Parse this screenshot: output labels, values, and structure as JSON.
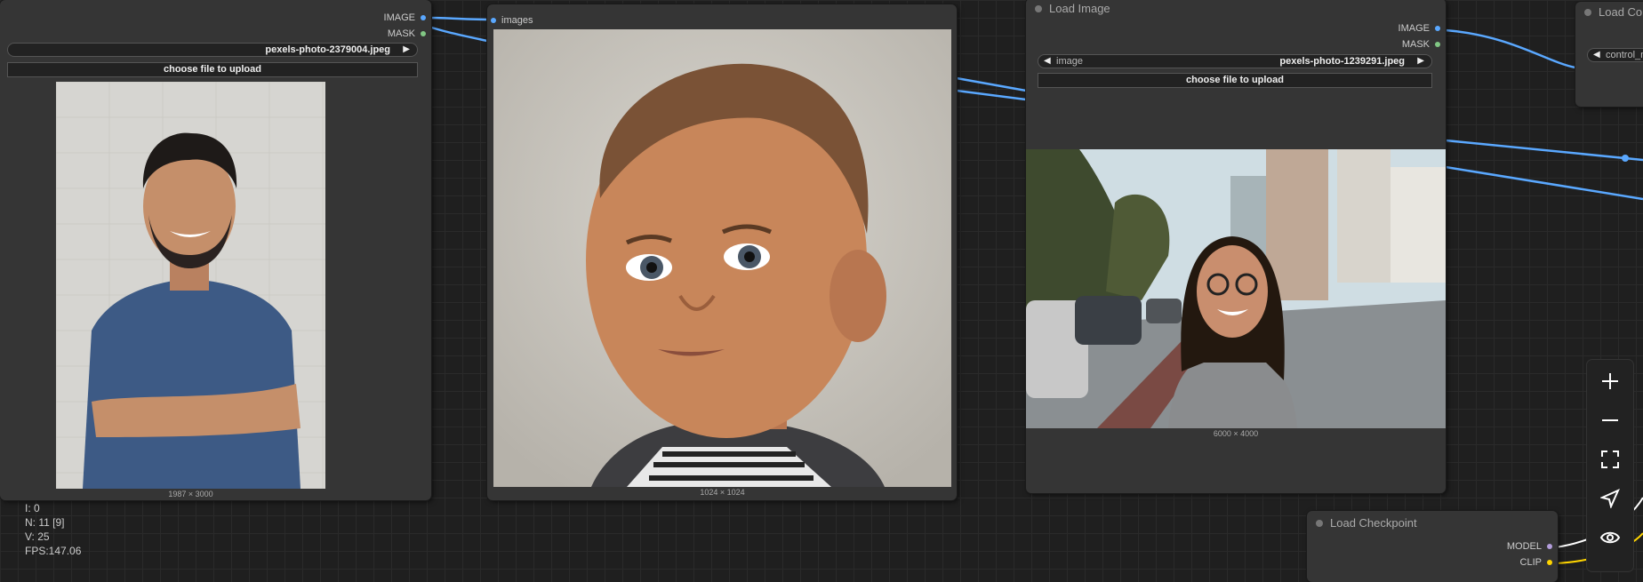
{
  "stats": {
    "i": "I: 0",
    "n": "N: 11 [9]",
    "v": "V: 25",
    "fps": "FPS:147.06"
  },
  "node_left": {
    "outputs": {
      "image": "IMAGE",
      "mask": "MASK"
    },
    "file": "pexels-photo-2379004.jpeg",
    "upload_label": "choose file to upload",
    "dims": "1987 × 3000"
  },
  "node_preview": {
    "input": "images",
    "dims": "1024 × 1024"
  },
  "node_load_image": {
    "title": "Load Image",
    "outputs": {
      "image": "IMAGE",
      "mask": "MASK"
    },
    "combo_label": "image",
    "file": "pexels-photo-1239291.jpeg",
    "upload_label": "choose file to upload",
    "dims": "6000 × 4000"
  },
  "node_load_controlnet": {
    "title": "Load Co",
    "combo_label": "control_n"
  },
  "node_checkpoint": {
    "title": "Load Checkpoint",
    "outputs": {
      "model": "MODEL",
      "clip": "CLIP"
    }
  },
  "colors": {
    "image_wire": "#5aa8ff",
    "mask_pin": "#81c784",
    "model_pin": "#b39ddb",
    "clip_pin": "#ffd500"
  },
  "toolbar_icons": [
    "zoom-in-icon",
    "zoom-out-icon",
    "fit-view-icon",
    "navigate-icon",
    "visibility-icon"
  ]
}
